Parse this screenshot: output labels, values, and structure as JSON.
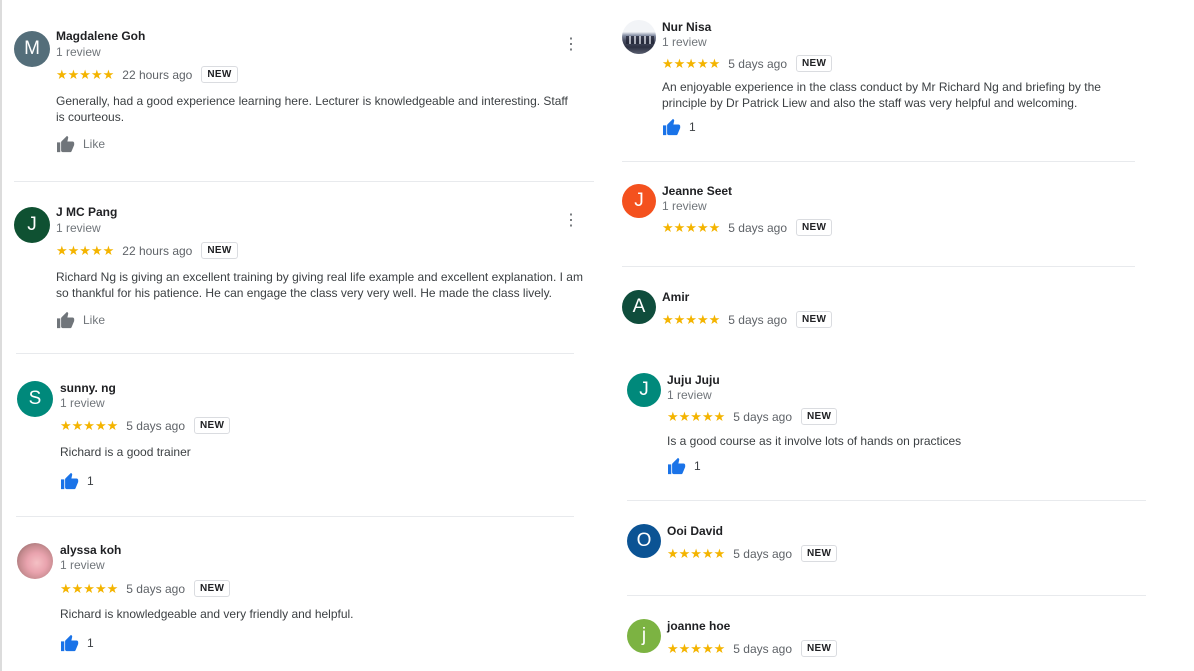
{
  "left_reviews": [
    {
      "name": "Magdalene Goh",
      "count": "1 review",
      "initial": "M",
      "avatar_color": "#546e7a",
      "stars": "★★★★★",
      "time": "22 hours ago",
      "badge": "NEW",
      "text": "Generally, had a good experience learning here. Lecturer is knowledgeable and interesting. Staff is courteous.",
      "like_label": "Like"
    },
    {
      "name": "J MC Pang",
      "count": "1 review",
      "initial": "J",
      "avatar_color": "#0f5132",
      "stars": "★★★★★",
      "time": "22 hours ago",
      "badge": "NEW",
      "text": "Richard Ng is giving an excellent training by giving real life example and excellent explanation. I am so thankful for his patience. He can engage the class very very well. He made the class lively.",
      "like_label": "Like"
    },
    {
      "name": "sunny. ng",
      "count": "1 review",
      "initial": "S",
      "avatar_color": "#00897b",
      "stars": "★★★★★",
      "time": "5 days ago",
      "badge": "NEW",
      "text": "Richard is a good trainer",
      "like_count": "1"
    },
    {
      "name": "alyssa koh",
      "count": "1 review",
      "stars": "★★★★★",
      "time": "5 days ago",
      "badge": "NEW",
      "text": "Richard is knowledgeable and very friendly and helpful.",
      "like_count": "1"
    }
  ],
  "right_reviews": [
    {
      "name": "Nur Nisa",
      "count": "1 review",
      "stars": "★★★★★",
      "time": "5 days ago",
      "badge": "NEW",
      "text": "An enjoyable experience in the class conduct by Mr Richard Ng and briefing by the principle by Dr Patrick Liew and also the staff was very helpful and welcoming.",
      "like_count": "1"
    },
    {
      "name": "Jeanne Seet",
      "count": "1 review",
      "initial": "J",
      "avatar_color": "#f4511e",
      "stars": "★★★★★",
      "time": "5 days ago",
      "badge": "NEW"
    },
    {
      "name": "Amir",
      "initial": "A",
      "avatar_color": "#0f4d3c",
      "stars": "★★★★★",
      "time": "5 days ago",
      "badge": "NEW"
    },
    {
      "name": "Juju Juju",
      "count": "1 review",
      "initial": "J",
      "avatar_color": "#00897b",
      "stars": "★★★★★",
      "time": "5 days ago",
      "badge": "NEW",
      "text": "Is a good course as it involve lots of hands on practices",
      "like_count": "1"
    },
    {
      "name": "Ooi David",
      "initial": "O",
      "avatar_color": "#0b5394",
      "stars": "★★★★★",
      "time": "5 days ago",
      "badge": "NEW"
    },
    {
      "name": "joanne hoe",
      "initial": "j",
      "avatar_color": "#7cb342",
      "stars": "★★★★★",
      "time": "5 days ago",
      "badge": "NEW"
    }
  ],
  "colors": {
    "star": "#f4b400",
    "like_blue": "#1a73e8",
    "like_grey": "#70757a"
  },
  "icons": {
    "menu": "more-vert-icon",
    "like": "thumb-up-icon"
  }
}
